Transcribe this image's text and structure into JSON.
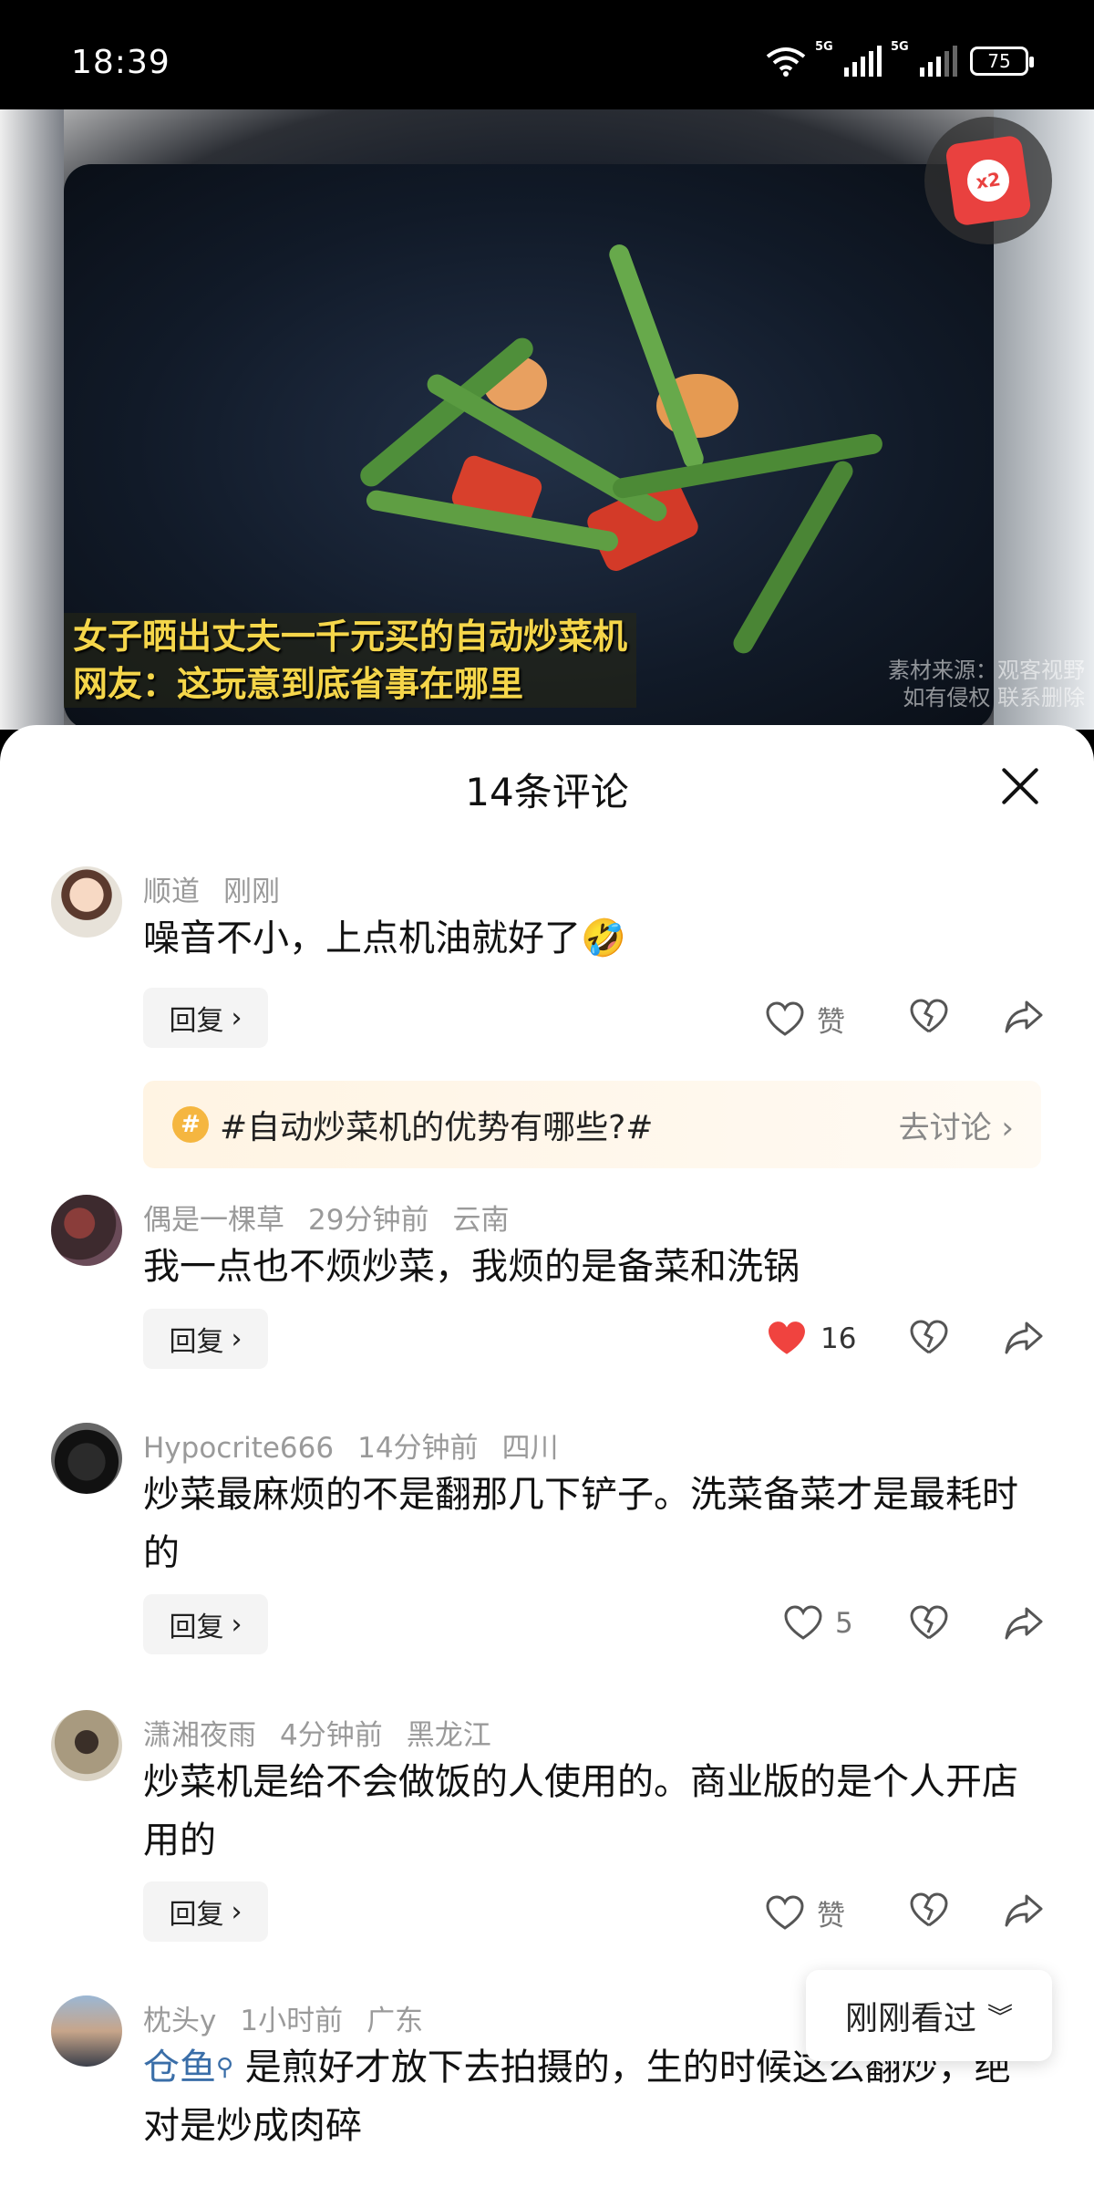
{
  "status_bar": {
    "time": "18:39",
    "battery": "75",
    "network1": "5G",
    "network2": "5G"
  },
  "video": {
    "caption_line1": "女子晒出丈夫一千元买的自动炒菜机",
    "caption_line2": "网友：这玩意到底省事在哪里",
    "watermark_line1": "素材来源：观客视野",
    "watermark_line2": "如有侵权 联系删除",
    "badge": "x2"
  },
  "sheet": {
    "title": "14条评论"
  },
  "reply_label": "回复",
  "topic": {
    "text": "#自动炒菜机的优势有哪些?#",
    "action": "去讨论"
  },
  "comments": [
    {
      "user": "顺道",
      "time": "刚刚",
      "location": "",
      "text": "噪音不小，上点机油就好了🤣",
      "likes": "赞",
      "liked": false
    },
    {
      "user": "偶是一棵草",
      "time": "29分钟前",
      "location": "云南",
      "text": "我一点也不烦炒菜，我烦的是备菜和洗锅",
      "likes": "16",
      "liked": true
    },
    {
      "user": "Hypocrite666",
      "time": "14分钟前",
      "location": "四川",
      "text": "炒菜最麻烦的不是翻那几下铲子。洗菜备菜才是最耗时的",
      "likes": "5",
      "liked": false
    },
    {
      "user": "潇湘夜雨",
      "time": "4分钟前",
      "location": "黑龙江",
      "text": "炒菜机是给不会做饭的人使用的。商业版的是个人开店用的",
      "likes": "赞",
      "liked": false
    },
    {
      "user": "枕头y",
      "time": "1小时前",
      "location": "广东",
      "mention": "仓鱼",
      "text": "是煎好才放下去拍摄的，生的时候这么翻炒，绝对是炒成肉碎",
      "likes": "",
      "liked": false
    }
  ],
  "recent_button": "刚刚看过",
  "colors": {
    "liked": "#f0433f",
    "accent_link": "#3a6ea8",
    "caption": "#f5d64a"
  }
}
